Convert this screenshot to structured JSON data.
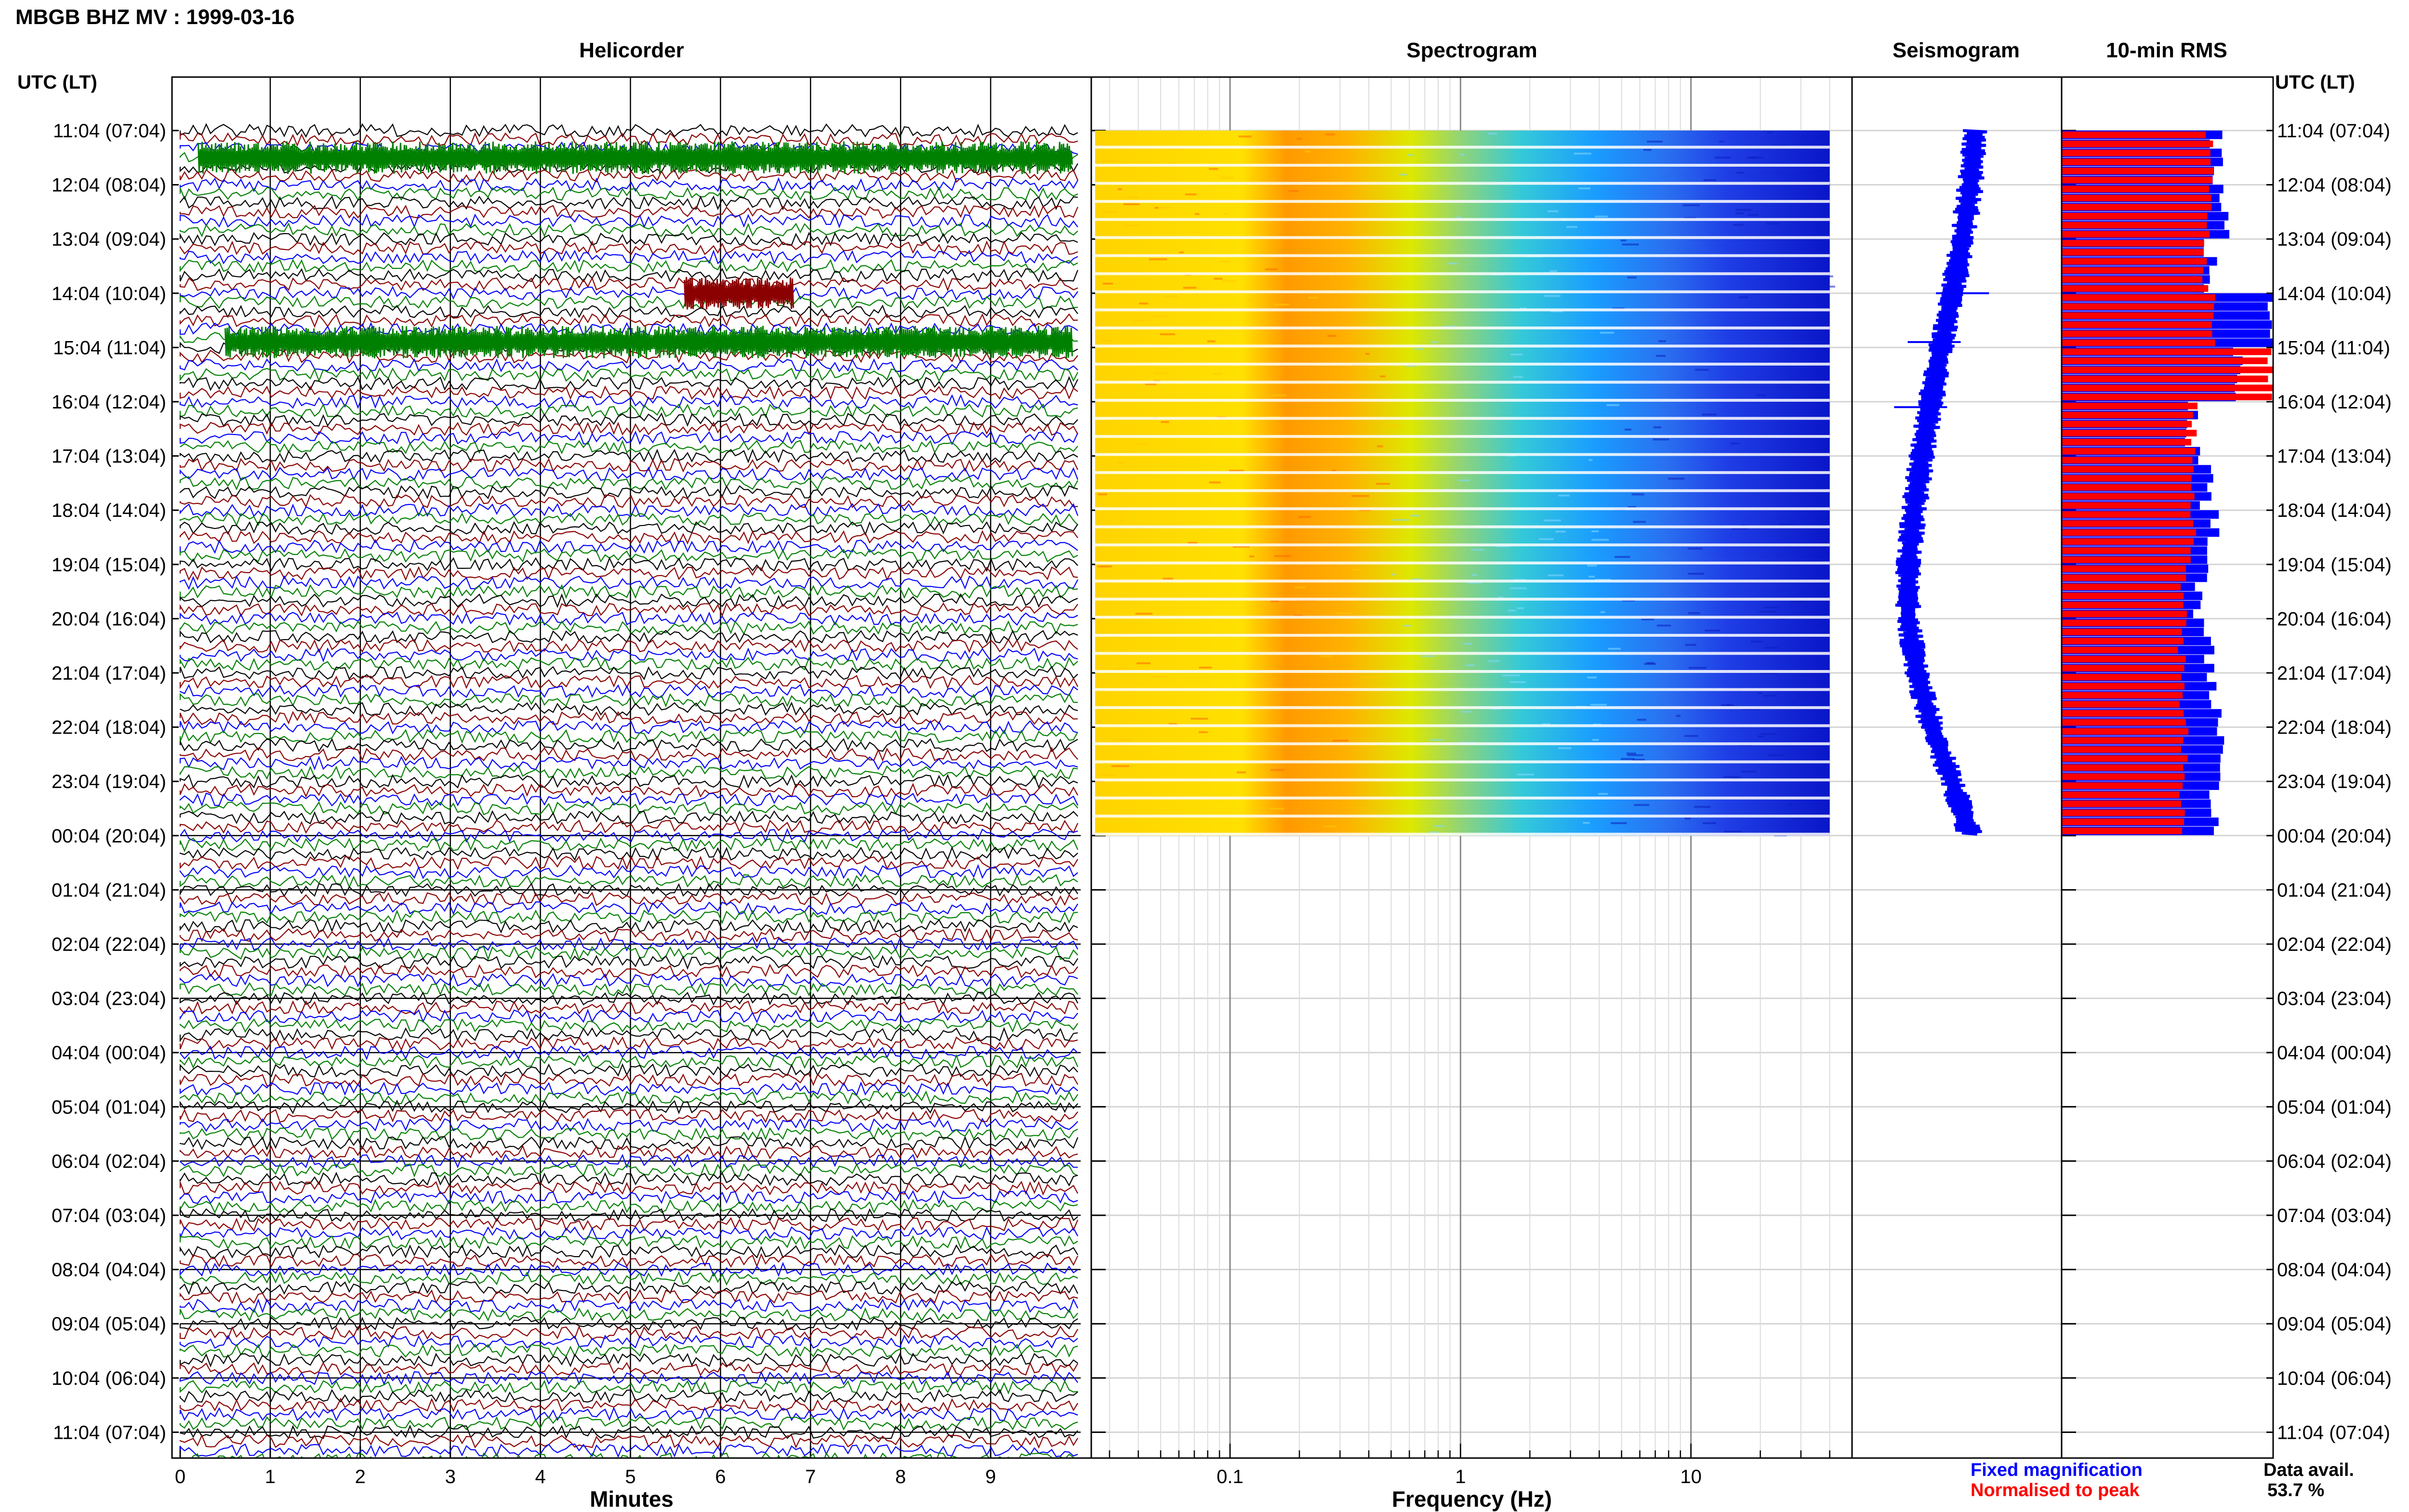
{
  "header": {
    "title": "MBGB BHZ MV : 1999-03-16"
  },
  "chart_data": {
    "type": "heatmap",
    "panels": [
      "Helicorder",
      "Spectrogram",
      "Seismogram",
      "10-min RMS"
    ],
    "left_axis_label": "UTC (LT)",
    "right_axis_label": "UTC (LT)",
    "rows": [
      "11:04 (07:04)",
      "12:04 (08:04)",
      "13:04 (09:04)",
      "14:04 (10:04)",
      "15:04 (11:04)",
      "16:04 (12:04)",
      "17:04 (13:04)",
      "18:04 (14:04)",
      "19:04 (15:04)",
      "20:04 (16:04)",
      "21:04 (17:04)",
      "22:04 (18:04)",
      "23:04 (19:04)",
      "00:04 (20:04)",
      "01:04 (21:04)",
      "02:04 (22:04)",
      "03:04 (23:04)",
      "04:04 (00:04)",
      "05:04 (01:04)",
      "06:04 (02:04)",
      "07:04 (03:04)",
      "08:04 (04:04)",
      "09:04 (05:04)",
      "10:04 (06:04)",
      "11:04 (07:04)"
    ],
    "helicorder": {
      "xlabel": "Minutes",
      "xticks": [
        "0",
        "1",
        "2",
        "3",
        "4",
        "5",
        "6",
        "7",
        "8",
        "9"
      ],
      "xlim": [
        0,
        10
      ],
      "data_rows_hours": 13,
      "colors": [
        "#000000",
        "#8b0000",
        "#0000ff",
        "#008000"
      ],
      "events": [
        {
          "hour_offset": 3.0,
          "start_min": 5.6,
          "end_min": 6.8,
          "color": "#8b0000"
        },
        {
          "hour_offset": 3.9,
          "start_min": 0.5,
          "end_min": 9.9,
          "color": "#008000"
        },
        {
          "hour_offset": 0.5,
          "start_min": 0.2,
          "end_min": 9.9,
          "color": "#008000"
        }
      ]
    },
    "spectrogram": {
      "xlabel": "Frequency (Hz)",
      "xscale": "log",
      "xlim": [
        0.025,
        50
      ],
      "xticks": [
        "0.1",
        "1",
        "10"
      ],
      "data_fmax": 40
    },
    "seismogram": {
      "hour_offsets": [
        0,
        1,
        2,
        3,
        4,
        5,
        6,
        7,
        8,
        9,
        10,
        11,
        12,
        13
      ],
      "level": [
        0.66,
        0.62,
        0.55,
        0.46,
        0.36,
        0.27,
        0.19,
        0.12,
        0.07,
        0.07,
        0.15,
        0.28,
        0.46,
        0.62
      ],
      "color": "#0000ff"
    },
    "rms": {
      "fixed_magnification": [
        0.74,
        0.76,
        0.71,
        0.99,
        0.82,
        0.62,
        0.68,
        0.71,
        0.66,
        0.69,
        0.72,
        0.75,
        0.71
      ],
      "normalised_to_peak": [
        0.7,
        0.69,
        0.68,
        0.72,
        0.99,
        0.63,
        0.62,
        0.62,
        0.58,
        0.57,
        0.57,
        0.58,
        0.57
      ],
      "fixed_color": "#0000ff",
      "normalised_color": "#ff0000"
    },
    "legend": {
      "fixed": "Fixed magnification",
      "normalised": "Normalised to peak",
      "avail_label": "Data avail.",
      "avail_value": "53.7 %"
    },
    "grid": true
  }
}
